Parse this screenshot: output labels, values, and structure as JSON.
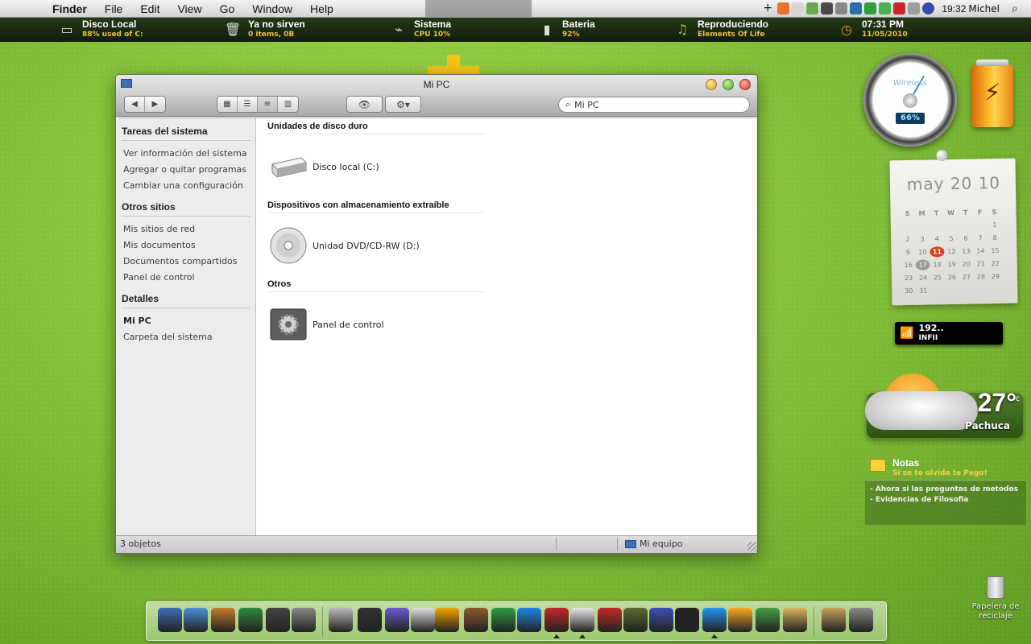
{
  "menubar": {
    "apple_glyph": "",
    "app_name": "Finder",
    "menus": [
      "File",
      "Edit",
      "View",
      "Go",
      "Window",
      "Help"
    ],
    "clock": "19:32",
    "user": "Michel"
  },
  "statusbar": {
    "items": [
      {
        "title": "Disco Local",
        "sub": "88% used of C:",
        "icon": "hard-drive-icon"
      },
      {
        "title": "Ya no sirven",
        "sub": "0 items, 0B",
        "icon": "trash-icon"
      },
      {
        "title": "Sistema",
        "sub": "CPU 10%",
        "icon": "monitor-icon"
      },
      {
        "title": "Bateria",
        "sub": "92%",
        "icon": "battery-icon"
      },
      {
        "title": "Reproduciendo",
        "sub": "Elements Of Life",
        "icon": "music-note-icon"
      },
      {
        "title": "07:31 PM",
        "sub": "11/05/2010",
        "icon": "clock-icon"
      }
    ]
  },
  "window": {
    "title": "Mi PC",
    "search_value": "Mi PC",
    "sidebar": {
      "groups": [
        {
          "heading": "Tareas del sistema",
          "items": [
            "Ver información del sistema",
            "Agregar o quitar programas",
            "Cambiar una configuración"
          ]
        },
        {
          "heading": "Otros sitios",
          "items": [
            "Mis sitios de red",
            "Mis documentos",
            "Documentos compartidos",
            "Panel de control"
          ]
        },
        {
          "heading": "Detalles",
          "items": [
            "Mi PC",
            "Carpeta del sistema"
          ]
        }
      ]
    },
    "sections": [
      {
        "heading": "Unidades de disco duro",
        "item": "Disco local (C:)",
        "icon": "hard-disk-icon"
      },
      {
        "heading": "Dispositivos con almacenamiento extraíble",
        "item": "Unidad DVD/CD-RW (D:)",
        "icon": "cd-drive-icon"
      },
      {
        "heading": "Otros",
        "item": "Panel de control",
        "icon": "control-panel-icon"
      }
    ],
    "status_left": "3 objetos",
    "status_right": "Mi equipo"
  },
  "widgets": {
    "wireless": {
      "label": "Wireless",
      "percent": "66%"
    },
    "calendar": {
      "month_title": "may 20 10",
      "weekdays": [
        "S",
        "M",
        "T",
        "W",
        "T",
        "F",
        "S"
      ],
      "days": [
        "",
        "",
        "",
        "",
        "",
        "",
        "1",
        "2",
        "3",
        "4",
        "5",
        "6",
        "7",
        "8",
        "9",
        "10",
        "11",
        "12",
        "13",
        "14",
        "15",
        "16",
        "17",
        "18",
        "19",
        "20",
        "21",
        "22",
        "23",
        "24",
        "25",
        "26",
        "27",
        "28",
        "29",
        "30",
        "31"
      ],
      "today": "11",
      "highlight": "17"
    },
    "wifi_box": {
      "line1": "192..",
      "line2": "INFII"
    },
    "weather": {
      "temp": "27°",
      "unit": "c",
      "city": "Pachuca"
    },
    "notes": {
      "title": "Notas",
      "subtitle": "Si se te olvida te Pego!",
      "lines": [
        "- Ahora si las preguntas de metodos",
        "- Evidencias de Filosofia"
      ]
    },
    "trash": {
      "label_line1": "Papelera de",
      "label_line2": "reciclaje"
    }
  },
  "colors": {
    "desktop_green": "#86c13a",
    "status_accent": "#e7c246",
    "today_red": "#d8401c"
  },
  "dock": {
    "icons": [
      "monitor-icon",
      "finder-icon",
      "photos-icon",
      "folder-green-icon",
      "headphones-icon",
      "gear-app-icon",
      "thermometer-icon",
      "clapperboard-icon",
      "display-icon",
      "notepad-icon",
      "office-icon",
      "squirrel-icon",
      "chrome-icon",
      "safari-icon",
      "can-icon",
      "wifi-icon",
      "red-bird-icon",
      "alien-icon",
      "gamepad-icon",
      "quill-icon",
      "messenger-icon",
      "photo-folder-icon",
      "download-icon",
      "box-icon",
      "package-icon",
      "tools-icon"
    ]
  }
}
